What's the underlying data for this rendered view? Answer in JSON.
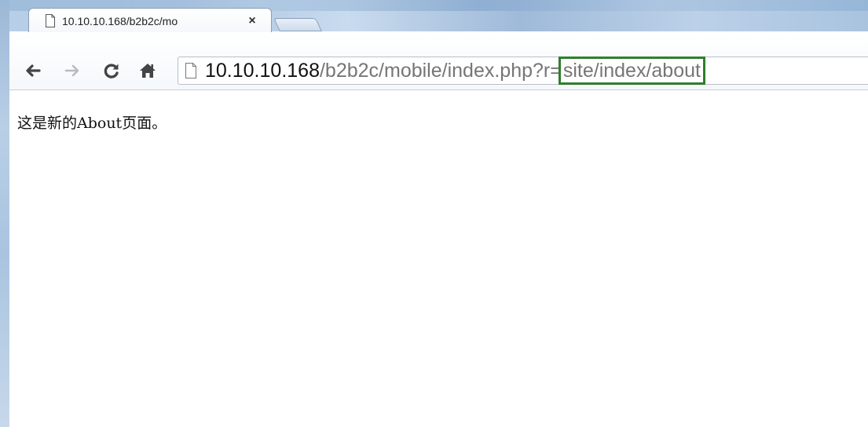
{
  "tab": {
    "title": "10.10.10.168/b2b2c/mo",
    "close_label": "×",
    "icon": "page-icon"
  },
  "new_tab": {
    "icon": "new-tab-icon"
  },
  "nav": {
    "back_icon": "arrow-left-icon",
    "forward_icon": "arrow-right-icon",
    "reload_icon": "reload-icon",
    "home_icon": "home-icon"
  },
  "omnibox": {
    "host": "10.10.10.168",
    "path": "/b2b2c/mobile/index.php?r=",
    "highlighted": "site/index/about",
    "highlight_color": "#2d7f2d"
  },
  "page": {
    "text": "这是新的About页面。"
  }
}
